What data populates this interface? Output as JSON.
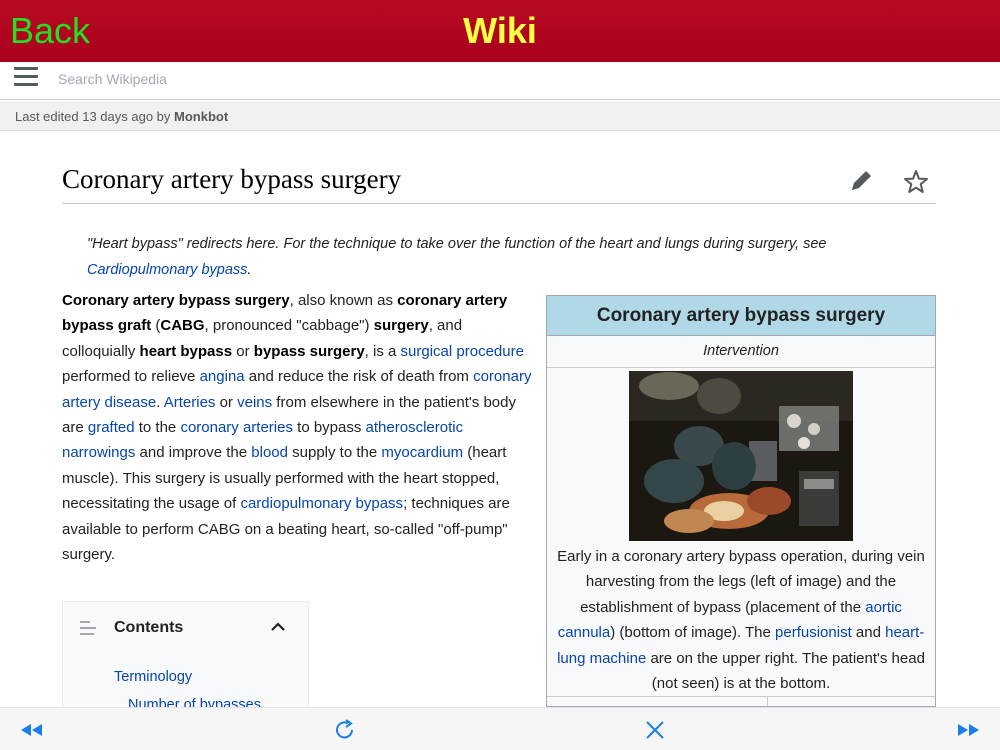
{
  "appbar": {
    "back_label": "Back",
    "title": "Wiki"
  },
  "search": {
    "placeholder": "Search Wikipedia"
  },
  "last_edited": {
    "prefix": "Last edited 13 days ago by ",
    "user": "Monkbot"
  },
  "article": {
    "title": "Coronary artery bypass surgery",
    "hatnote": {
      "text": "\"Heart bypass\" redirects here. For the technique to take over the function of the heart and lungs during surgery, see ",
      "link": "Cardiopulmonary bypass",
      "end": "."
    },
    "lead": {
      "b1": "Coronary artery bypass surgery",
      "t1": ", also known as ",
      "b2": "coronary artery bypass graft",
      "t2": " (",
      "b3": "CABG",
      "t3": ", pronounced \"cabbage\") ",
      "b4": "surgery",
      "t4": ", and colloquially ",
      "b5": "heart bypass",
      "t5": " or ",
      "b6": "bypass surgery",
      "t6": ", is a ",
      "l1": "surgical procedure",
      "t7": " performed to relieve ",
      "l2": "angina",
      "t8": " and reduce the risk of death from ",
      "l3": "coronary artery disease",
      "t9": ". ",
      "l4": "Arteries",
      "t10": " or ",
      "l5": "veins",
      "t11": " from elsewhere in the patient's body are ",
      "l6": "grafted",
      "t12": " to the ",
      "l7": "coronary arteries",
      "t13": " to bypass ",
      "l8": "atherosclerotic narrowings",
      "t14": " and improve the ",
      "l9": "blood",
      "t15": " supply to the ",
      "l10": "myocardium",
      "t16": " (heart muscle). This surgery is usually performed with the heart stopped, necessitating the usage of ",
      "l11": "cardiopulmonary bypass",
      "t17": "; techniques are available to perform CABG on a beating heart, so-called \"off-pump\" surgery."
    },
    "infobox": {
      "title": "Coronary artery bypass surgery",
      "subtitle": "Intervention",
      "caption": {
        "t1": "Early in a coronary artery bypass operation, during vein harvesting from the legs (left of image) and the establishment of bypass (placement of the ",
        "l1": "aortic cannula",
        "t2": ") (bottom of image). The ",
        "l2": "perfusionist",
        "t3": " and ",
        "l3": "heart-lung machine",
        "t4": " are on the upper right. The patient's head (not seen) is at the bottom."
      }
    },
    "contents": {
      "title": "Contents",
      "items": [
        "Terminology",
        "Number of bypasses"
      ]
    }
  },
  "toolbar": {
    "icons": [
      "rewind-icon",
      "reload-icon",
      "close-icon",
      "fast-forward-icon"
    ],
    "accent": "#1a7ee8"
  },
  "colors": {
    "appbar": "#a8001c",
    "back": "#22e022",
    "title": "#ffff44",
    "link": "#0645ad"
  }
}
